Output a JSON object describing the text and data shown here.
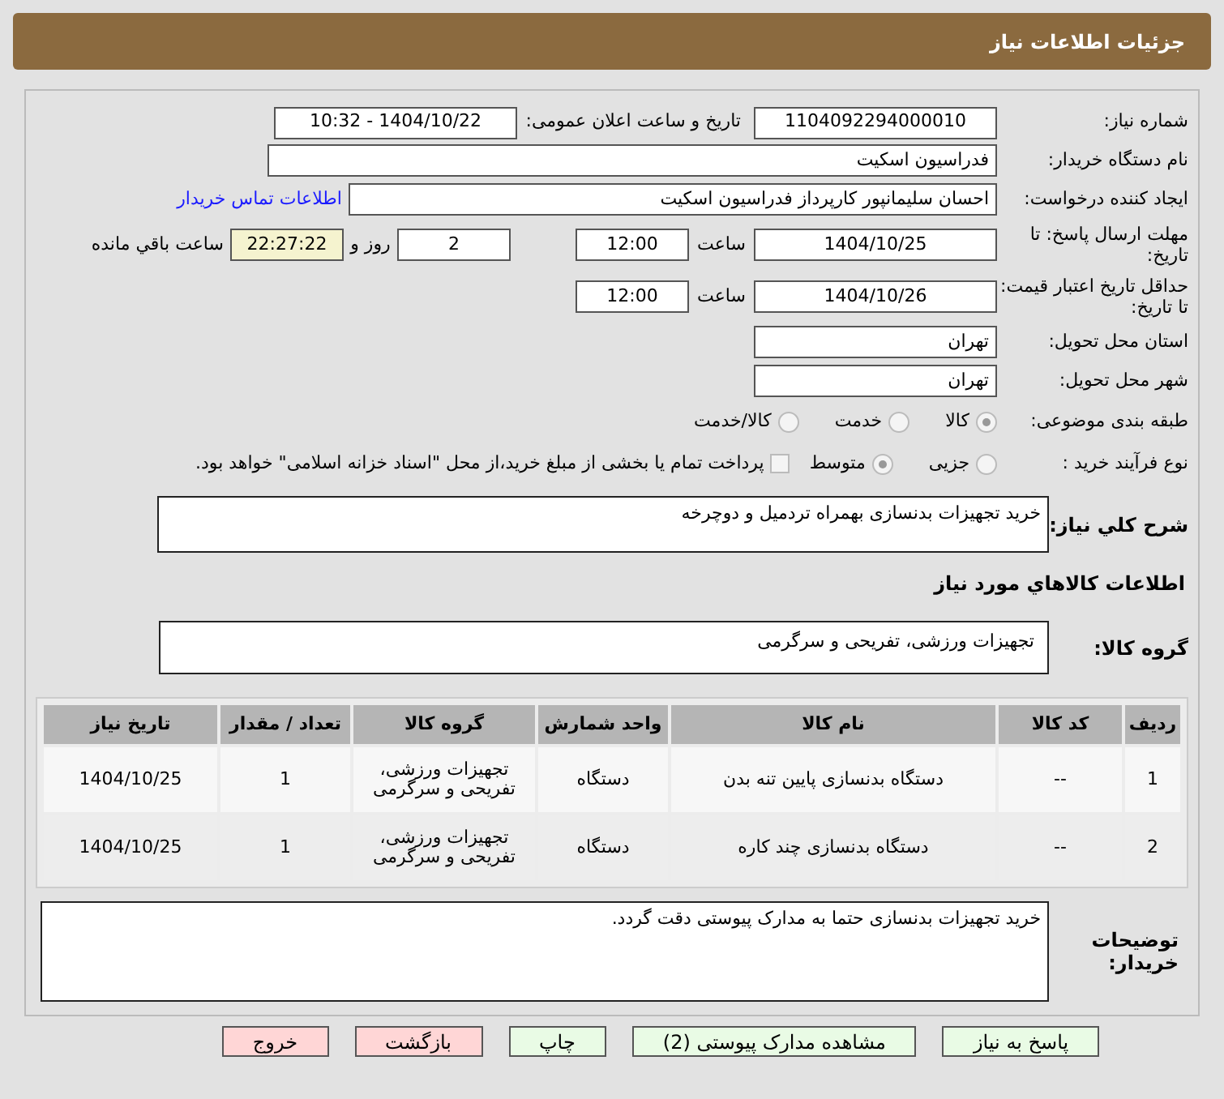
{
  "header": {
    "title": "جزئیات اطلاعات نیاز"
  },
  "need_number": {
    "label": "شماره نیاز:",
    "value": "1104092294000010"
  },
  "announce": {
    "label": "تاریخ و ساعت اعلان عمومی:",
    "value": "1404/10/22 - 10:32"
  },
  "buyer": {
    "label": "نام دستگاه خریدار:",
    "value": "فدراسیون اسکیت"
  },
  "creator": {
    "label": "ایجاد کننده درخواست:",
    "value": "احسان سلیمانپور کارپرداز فدراسیون اسکیت",
    "link": "اطلاعات تماس خریدار"
  },
  "deadline": {
    "label": "مهلت ارسال پاسخ: تا تاریخ:",
    "date": "1404/10/25",
    "time_label": "ساعت",
    "time": "12:00",
    "days": "2",
    "days_label": "روز و",
    "remaining": "22:27:22",
    "remaining_label": "ساعت باقي مانده"
  },
  "validity": {
    "label": "حداقل تاریخ اعتبار قیمت: تا تاریخ:",
    "date": "1404/10/26",
    "time_label": "ساعت",
    "time": "12:00"
  },
  "province": {
    "label": "استان محل تحویل:",
    "value": "تهران"
  },
  "city": {
    "label": "شهر محل تحویل:",
    "value": "تهران"
  },
  "category": {
    "label": "طبقه بندی موضوعی:",
    "options": [
      {
        "label": "کالا",
        "selected": true
      },
      {
        "label": "خدمت",
        "selected": false
      },
      {
        "label": "کالا/خدمت",
        "selected": false
      }
    ]
  },
  "process": {
    "label": "نوع فرآیند خرید :",
    "options": [
      {
        "label": "جزیی",
        "selected": false
      },
      {
        "label": "متوسط",
        "selected": true
      }
    ],
    "payment": {
      "checked": false,
      "text": "پرداخت تمام یا بخشی از مبلغ خرید،از محل \"اسناد خزانه اسلامی\" خواهد بود."
    }
  },
  "description": {
    "label": "شرح کلي نیاز:",
    "value": "خرید تجهیزات بدنسازی بهمراه تردمیل و دوچرخه"
  },
  "goods_heading": "اطلاعات کالاهاي مورد نیاز",
  "goods_group": {
    "label": "گروه کالا:",
    "value": "تجهیزات ورزشی، تفریحی و سرگرمی"
  },
  "table": {
    "columns": [
      "ردیف",
      "کد کالا",
      "نام کالا",
      "واحد شمارش",
      "گروه کالا",
      "تعداد / مقدار",
      "تاریخ نیاز"
    ],
    "rows": [
      [
        "1",
        "--",
        "دستگاه بدنسازی پایین تنه بدن",
        "دستگاه",
        "تجهیزات ورزشی، تفریحی و سرگرمی",
        "1",
        "1404/10/25"
      ],
      [
        "2",
        "--",
        "دستگاه بدنسازی چند کاره",
        "دستگاه",
        "تجهیزات ورزشی، تفریحی و سرگرمی",
        "1",
        "1404/10/25"
      ]
    ]
  },
  "notes": {
    "label": "توضیحات خریدار:",
    "value": "خرید تجهیزات بدنسازی حتما به مدارک پیوستی دقت گردد."
  },
  "buttons": [
    {
      "label": "پاسخ به نیاز",
      "kind": "action"
    },
    {
      "label": "مشاهده مدارک پیوستی (2)",
      "kind": "action"
    },
    {
      "label": "چاپ",
      "kind": "action"
    },
    {
      "label": "بازگشت",
      "kind": "exit"
    },
    {
      "label": "خروج",
      "kind": "exit"
    }
  ]
}
